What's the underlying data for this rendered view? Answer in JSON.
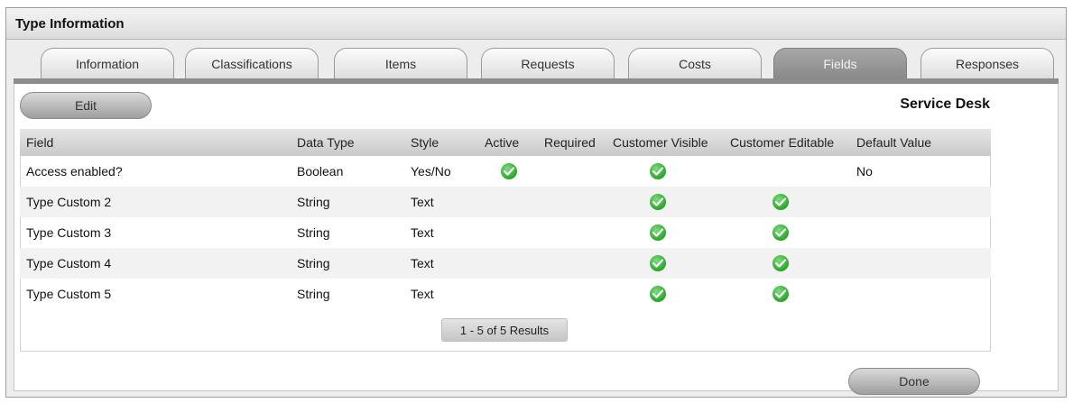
{
  "panel": {
    "title": "Type Information"
  },
  "tabs": [
    {
      "label": "Information",
      "active": false
    },
    {
      "label": "Classifications",
      "active": false
    },
    {
      "label": "Items",
      "active": false
    },
    {
      "label": "Requests",
      "active": false
    },
    {
      "label": "Costs",
      "active": false
    },
    {
      "label": "Fields",
      "active": true
    },
    {
      "label": "Responses",
      "active": false
    }
  ],
  "toolbar": {
    "edit_label": "Edit",
    "org_name": "Service Desk"
  },
  "table": {
    "columns": [
      "Field",
      "Data Type",
      "Style",
      "Active",
      "Required",
      "Customer Visible",
      "Customer Editable",
      "Default Value"
    ],
    "rows": [
      {
        "field": "Access enabled?",
        "data_type": "Boolean",
        "style": "Yes/No",
        "active": true,
        "required": false,
        "customer_visible": true,
        "customer_editable": false,
        "default_value": "No"
      },
      {
        "field": "Type Custom 2",
        "data_type": "String",
        "style": "Text",
        "active": false,
        "required": false,
        "customer_visible": true,
        "customer_editable": true,
        "default_value": ""
      },
      {
        "field": "Type Custom 3",
        "data_type": "String",
        "style": "Text",
        "active": false,
        "required": false,
        "customer_visible": true,
        "customer_editable": true,
        "default_value": ""
      },
      {
        "field": "Type Custom 4",
        "data_type": "String",
        "style": "Text",
        "active": false,
        "required": false,
        "customer_visible": true,
        "customer_editable": true,
        "default_value": ""
      },
      {
        "field": "Type Custom 5",
        "data_type": "String",
        "style": "Text",
        "active": false,
        "required": false,
        "customer_visible": true,
        "customer_editable": true,
        "default_value": ""
      }
    ],
    "pager_text": "1 - 5 of 5 Results"
  },
  "footer": {
    "done_label": "Done"
  },
  "colors": {
    "check_green": "#2aa52a",
    "active_tab": "#8a8a8a"
  }
}
